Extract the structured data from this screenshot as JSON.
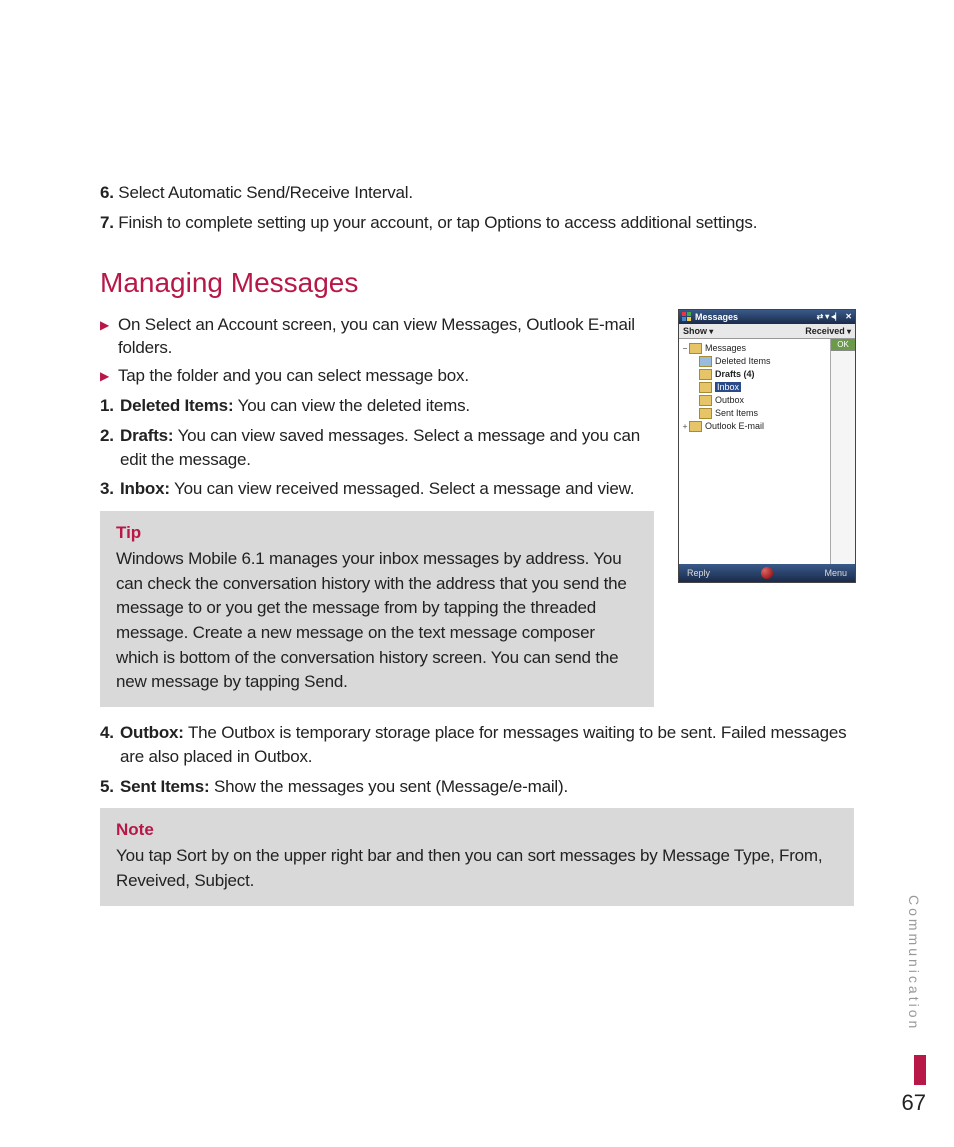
{
  "steps": {
    "six_num": "6.",
    "six_text": " Select Automatic Send/Receive Interval.",
    "seven_num": "7.",
    "seven_text": " Finish to complete setting up your account, or tap Options to access additional settings."
  },
  "heading": "Managing Messages",
  "bullets": {
    "b1": "On Select an Account screen, you can view Messages, Outlook E-mail folders.",
    "b2": "Tap the folder and you can select message box."
  },
  "list": {
    "n1": "1.",
    "l1": "Deleted Items:",
    "t1": " You can view the deleted items.",
    "n2": "2.",
    "l2": "Drafts:",
    "t2": " You can view saved messages. Select a message and you can edit the message.",
    "n3": "3.",
    "l3": "Inbox:",
    "t3": " You can view received messaged. Select a message and view.",
    "n4": "4.",
    "l4": "Outbox:",
    "t4": " The Outbox is temporary storage place for messages waiting to be sent. Failed messages are also placed in Outbox.",
    "n5": "5.",
    "l5": "Sent Items:",
    "t5": " Show the messages you sent (Message/e-mail)."
  },
  "tip": {
    "title": "Tip",
    "body": "Windows Mobile 6.1 manages your inbox messages by address. You can check the conversation history with the address that you send the message to or you get the message from by tapping the threaded message. Create a new message on the text message composer which is bottom of the conversation history screen. You can send the new message by tapping Send."
  },
  "note": {
    "title": "Note",
    "body": "You tap Sort by on the upper right bar and then you can sort messages by Message Type, From, Reveived, Subject."
  },
  "device": {
    "title": "Messages",
    "show": "Show",
    "received": "Received",
    "ok": "OK",
    "tree": {
      "root": "Messages",
      "deleted": "Deleted Items",
      "drafts": "Drafts  (4)",
      "inbox": "Inbox",
      "outbox": "Outbox",
      "sent": "Sent Items",
      "outlook": "Outlook E-mail"
    },
    "reply": "Reply",
    "menu": "Menu"
  },
  "sidetab": "Communication",
  "pageno": "67"
}
